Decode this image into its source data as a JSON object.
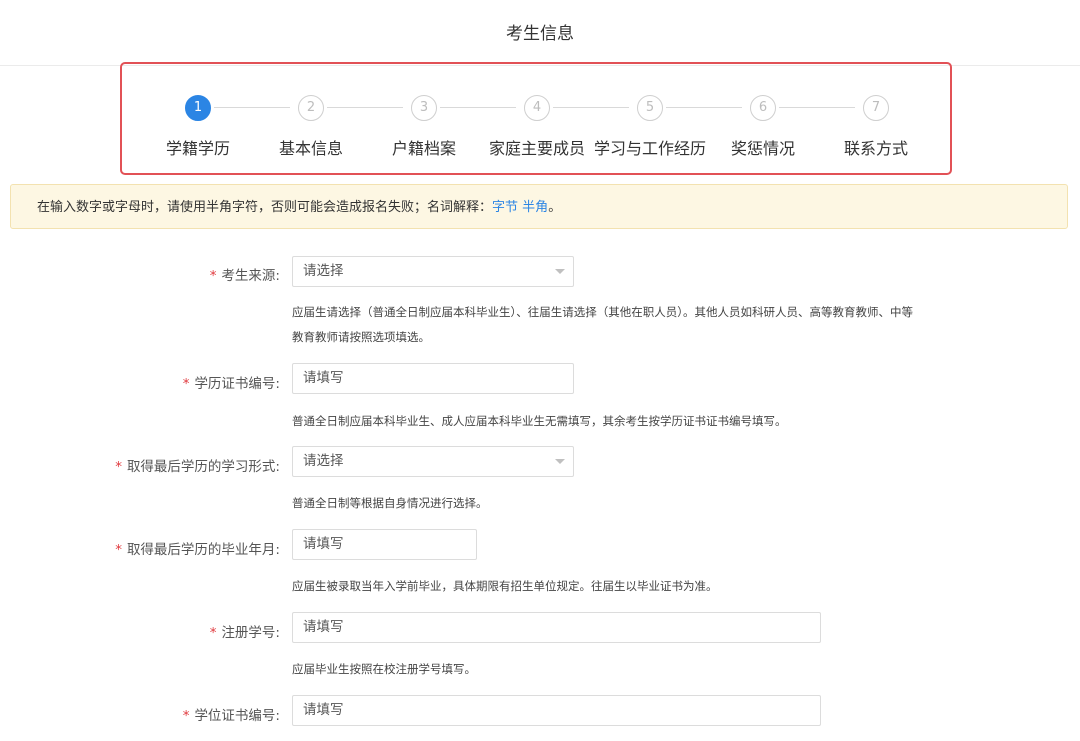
{
  "header": {
    "title": "考生信息"
  },
  "steps": [
    {
      "num": "1",
      "label": "学籍学历"
    },
    {
      "num": "2",
      "label": "基本信息"
    },
    {
      "num": "3",
      "label": "户籍档案"
    },
    {
      "num": "4",
      "label": "家庭主要成员"
    },
    {
      "num": "5",
      "label": "学习与工作经历"
    },
    {
      "num": "6",
      "label": "奖惩情况"
    },
    {
      "num": "7",
      "label": "联系方式"
    }
  ],
  "active_step": 1,
  "notice": {
    "text": "在输入数字或字母时，请使用半角字符，否则可能会造成报名失败；名词解释：",
    "link1": "字节",
    "link2": "半角",
    "end": "。"
  },
  "form": {
    "source": {
      "required": "*",
      "label": "考生来源:",
      "placeholder": "请选择",
      "hint1": "应届生请选择（普通全日制应届本科毕业生）、往届生请选择（其他在职人员）。其他人员如科研人员、高等教育教师、中等",
      "hint2": "教育教师请按照选项填选。"
    },
    "cert_no": {
      "required": "*",
      "label": "学历证书编号:",
      "placeholder": "请填写",
      "hint": "普通全日制应届本科毕业生、成人应届本科毕业生无需填写，其余考生按学历证书证书编号填写。"
    },
    "study_form": {
      "required": "*",
      "label": "取得最后学历的学习形式:",
      "placeholder": "请选择",
      "hint": "普通全日制等根据自身情况进行选择。"
    },
    "grad_date": {
      "required": "*",
      "label": "取得最后学历的毕业年月:",
      "placeholder": "请填写",
      "hint": "应届生被录取当年入学前毕业，具体期限有招生单位规定。往届生以毕业证书为准。"
    },
    "reg_no": {
      "required": "*",
      "label": "注册学号:",
      "placeholder": "请填写",
      "hint": "应届毕业生按照在校注册学号填写。"
    },
    "degree_no": {
      "required": "*",
      "label": "学位证书编号:",
      "placeholder": "请填写"
    }
  }
}
